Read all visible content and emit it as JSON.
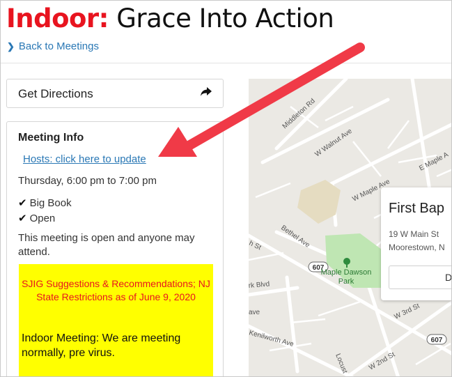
{
  "header": {
    "type_label": "Indoor:",
    "meeting_name": "Grace Into Action",
    "back_link": "Back to Meetings"
  },
  "directions": {
    "label": "Get Directions",
    "icon": "share-arrow-icon"
  },
  "meeting_info": {
    "title": "Meeting Info",
    "hosts_link": "Hosts: click here to update",
    "schedule": "Thursday, 6:00 pm to 7:00 pm",
    "types": [
      "Big Book",
      "Open"
    ],
    "description": "This meeting is open and anyone may attend.",
    "notes_red": "SJIG Suggestions & Recommendations; NJ State Restrictions as of June 9, 2020",
    "notes_black": "Indoor Meeting: We are meeting normally, pre virus."
  },
  "map": {
    "streets": [
      "Middleton Rd",
      "W Walnut Ave",
      "E Maple A",
      "W Maple Ave",
      "Bethel Ave",
      "h St",
      "rk Blvd",
      "ave",
      "W 3rd St",
      "Kenilworth Ave",
      "W 2nd St",
      "Locust"
    ],
    "route_badges": [
      "607",
      "607"
    ],
    "park_label": "Maple Dawson Park",
    "place": {
      "name": "First Bap",
      "address_line1": "19 W Main St",
      "address_line2": "Moorestown, N",
      "button_label": "D"
    }
  },
  "colors": {
    "accent_red": "#e8141f",
    "link_blue": "#2a78b5",
    "notes_bg": "#ffff00",
    "annotation_arrow": "#f03a47"
  }
}
